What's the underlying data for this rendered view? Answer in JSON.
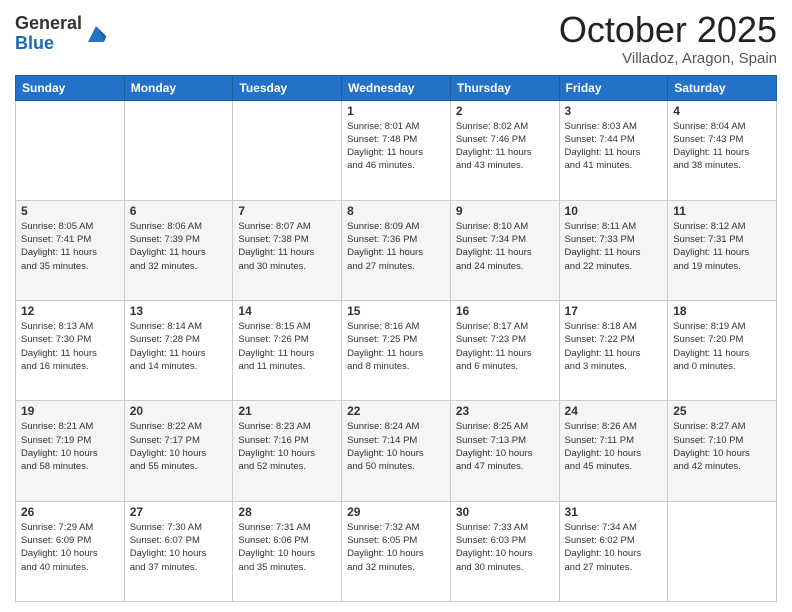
{
  "header": {
    "logo_general": "General",
    "logo_blue": "Blue",
    "month": "October 2025",
    "location": "Villadoz, Aragon, Spain"
  },
  "days_of_week": [
    "Sunday",
    "Monday",
    "Tuesday",
    "Wednesday",
    "Thursday",
    "Friday",
    "Saturday"
  ],
  "weeks": [
    [
      {
        "day": "",
        "info": ""
      },
      {
        "day": "",
        "info": ""
      },
      {
        "day": "",
        "info": ""
      },
      {
        "day": "1",
        "info": "Sunrise: 8:01 AM\nSunset: 7:48 PM\nDaylight: 11 hours\nand 46 minutes."
      },
      {
        "day": "2",
        "info": "Sunrise: 8:02 AM\nSunset: 7:46 PM\nDaylight: 11 hours\nand 43 minutes."
      },
      {
        "day": "3",
        "info": "Sunrise: 8:03 AM\nSunset: 7:44 PM\nDaylight: 11 hours\nand 41 minutes."
      },
      {
        "day": "4",
        "info": "Sunrise: 8:04 AM\nSunset: 7:43 PM\nDaylight: 11 hours\nand 38 minutes."
      }
    ],
    [
      {
        "day": "5",
        "info": "Sunrise: 8:05 AM\nSunset: 7:41 PM\nDaylight: 11 hours\nand 35 minutes."
      },
      {
        "day": "6",
        "info": "Sunrise: 8:06 AM\nSunset: 7:39 PM\nDaylight: 11 hours\nand 32 minutes."
      },
      {
        "day": "7",
        "info": "Sunrise: 8:07 AM\nSunset: 7:38 PM\nDaylight: 11 hours\nand 30 minutes."
      },
      {
        "day": "8",
        "info": "Sunrise: 8:09 AM\nSunset: 7:36 PM\nDaylight: 11 hours\nand 27 minutes."
      },
      {
        "day": "9",
        "info": "Sunrise: 8:10 AM\nSunset: 7:34 PM\nDaylight: 11 hours\nand 24 minutes."
      },
      {
        "day": "10",
        "info": "Sunrise: 8:11 AM\nSunset: 7:33 PM\nDaylight: 11 hours\nand 22 minutes."
      },
      {
        "day": "11",
        "info": "Sunrise: 8:12 AM\nSunset: 7:31 PM\nDaylight: 11 hours\nand 19 minutes."
      }
    ],
    [
      {
        "day": "12",
        "info": "Sunrise: 8:13 AM\nSunset: 7:30 PM\nDaylight: 11 hours\nand 16 minutes."
      },
      {
        "day": "13",
        "info": "Sunrise: 8:14 AM\nSunset: 7:28 PM\nDaylight: 11 hours\nand 14 minutes."
      },
      {
        "day": "14",
        "info": "Sunrise: 8:15 AM\nSunset: 7:26 PM\nDaylight: 11 hours\nand 11 minutes."
      },
      {
        "day": "15",
        "info": "Sunrise: 8:16 AM\nSunset: 7:25 PM\nDaylight: 11 hours\nand 8 minutes."
      },
      {
        "day": "16",
        "info": "Sunrise: 8:17 AM\nSunset: 7:23 PM\nDaylight: 11 hours\nand 6 minutes."
      },
      {
        "day": "17",
        "info": "Sunrise: 8:18 AM\nSunset: 7:22 PM\nDaylight: 11 hours\nand 3 minutes."
      },
      {
        "day": "18",
        "info": "Sunrise: 8:19 AM\nSunset: 7:20 PM\nDaylight: 11 hours\nand 0 minutes."
      }
    ],
    [
      {
        "day": "19",
        "info": "Sunrise: 8:21 AM\nSunset: 7:19 PM\nDaylight: 10 hours\nand 58 minutes."
      },
      {
        "day": "20",
        "info": "Sunrise: 8:22 AM\nSunset: 7:17 PM\nDaylight: 10 hours\nand 55 minutes."
      },
      {
        "day": "21",
        "info": "Sunrise: 8:23 AM\nSunset: 7:16 PM\nDaylight: 10 hours\nand 52 minutes."
      },
      {
        "day": "22",
        "info": "Sunrise: 8:24 AM\nSunset: 7:14 PM\nDaylight: 10 hours\nand 50 minutes."
      },
      {
        "day": "23",
        "info": "Sunrise: 8:25 AM\nSunset: 7:13 PM\nDaylight: 10 hours\nand 47 minutes."
      },
      {
        "day": "24",
        "info": "Sunrise: 8:26 AM\nSunset: 7:11 PM\nDaylight: 10 hours\nand 45 minutes."
      },
      {
        "day": "25",
        "info": "Sunrise: 8:27 AM\nSunset: 7:10 PM\nDaylight: 10 hours\nand 42 minutes."
      }
    ],
    [
      {
        "day": "26",
        "info": "Sunrise: 7:29 AM\nSunset: 6:09 PM\nDaylight: 10 hours\nand 40 minutes."
      },
      {
        "day": "27",
        "info": "Sunrise: 7:30 AM\nSunset: 6:07 PM\nDaylight: 10 hours\nand 37 minutes."
      },
      {
        "day": "28",
        "info": "Sunrise: 7:31 AM\nSunset: 6:06 PM\nDaylight: 10 hours\nand 35 minutes."
      },
      {
        "day": "29",
        "info": "Sunrise: 7:32 AM\nSunset: 6:05 PM\nDaylight: 10 hours\nand 32 minutes."
      },
      {
        "day": "30",
        "info": "Sunrise: 7:33 AM\nSunset: 6:03 PM\nDaylight: 10 hours\nand 30 minutes."
      },
      {
        "day": "31",
        "info": "Sunrise: 7:34 AM\nSunset: 6:02 PM\nDaylight: 10 hours\nand 27 minutes."
      },
      {
        "day": "",
        "info": ""
      }
    ]
  ]
}
